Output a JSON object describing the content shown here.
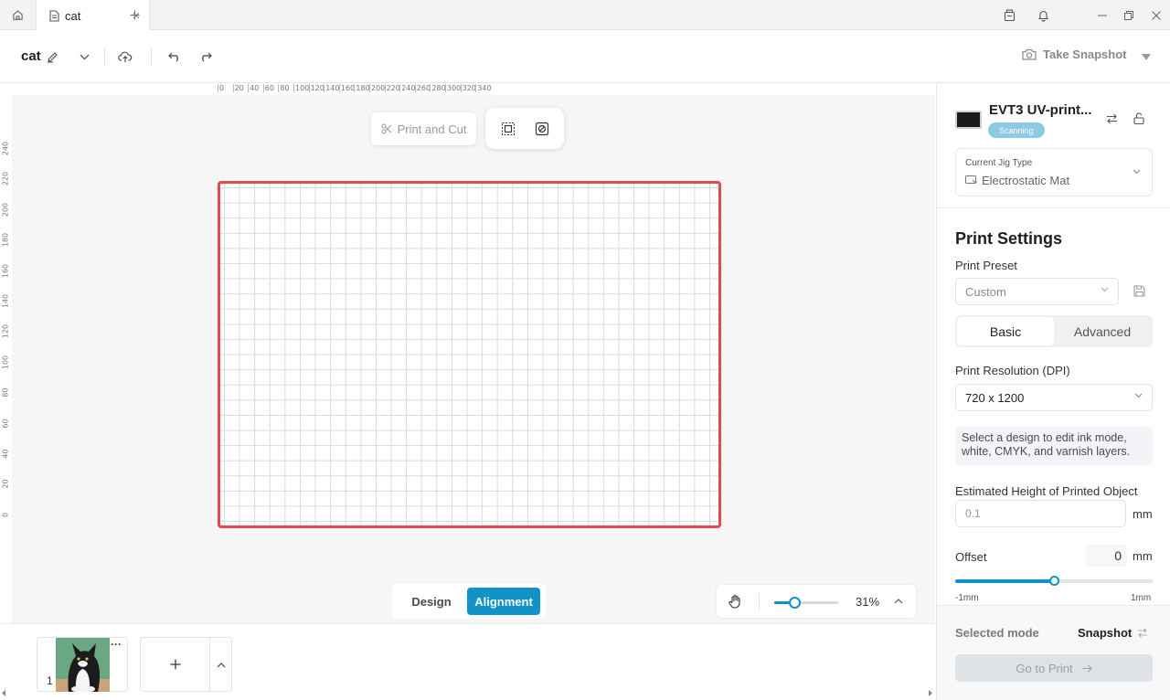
{
  "tabs": {
    "active_tab": "cat"
  },
  "toolbar": {
    "doc_title": "cat",
    "snapshot_label": "Take Snapshot"
  },
  "canvas": {
    "ruler_top": [
      "0",
      "20",
      "40",
      "60",
      "80",
      "100",
      "120",
      "140",
      "160",
      "180",
      "200",
      "220",
      "240",
      "260",
      "280",
      "300",
      "320",
      "340"
    ],
    "ruler_left": [
      "240",
      "220",
      "200",
      "180",
      "160",
      "140",
      "120",
      "100",
      "80",
      "60",
      "40",
      "20",
      "0"
    ],
    "print_cut_label": "Print and Cut",
    "mode_design": "Design",
    "mode_alignment": "Alignment",
    "active_mode": "Alignment",
    "zoom_value": "31%",
    "zoom_level": 0.31,
    "board_border_color": "#e5484d"
  },
  "pages": {
    "items": [
      {
        "number": "1"
      }
    ]
  },
  "device": {
    "name": "EVT3 UV-print...",
    "status": "Scanning"
  },
  "jig": {
    "label": "Current Jig Type",
    "value": "Electrostatic Mat"
  },
  "print_settings": {
    "title": "Print Settings",
    "preset_label": "Print Preset",
    "preset_value": "Custom",
    "tab_basic": "Basic",
    "tab_advanced": "Advanced",
    "resolution_label": "Print Resolution (DPI)",
    "resolution_value": "720 x 1200",
    "info_text": "Select a design to edit ink mode, white, CMYK, and varnish layers.",
    "height_label": "Estimated Height of Printed Object",
    "height_placeholder": "0.1",
    "height_unit": "mm",
    "offset_label": "Offset",
    "offset_value": "0",
    "offset_unit": "mm",
    "offset_min": "-1mm",
    "offset_max": "1mm",
    "offset_level": 0.5
  },
  "footer": {
    "selected_mode_label": "Selected mode",
    "selected_mode_value": "Snapshot",
    "go_print_label": "Go to Print"
  },
  "colors": {
    "accent": "#1293c7",
    "badge": "#8fc9e5",
    "board_border": "#e5484d"
  }
}
